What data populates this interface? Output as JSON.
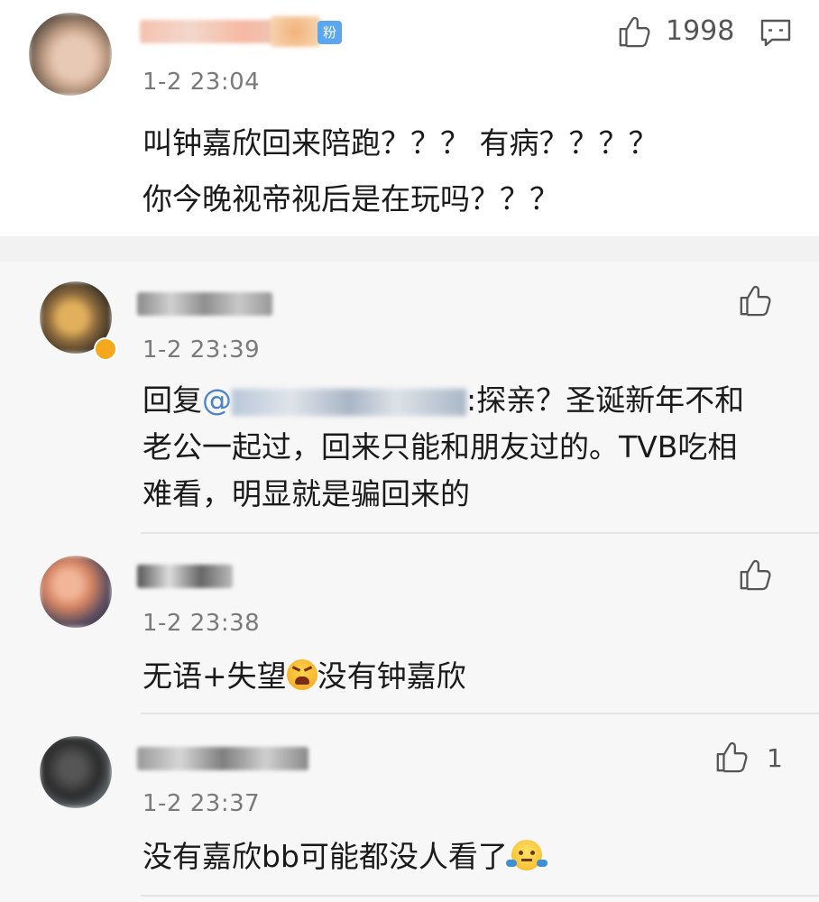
{
  "main_comment": {
    "fan_badge": "粉",
    "timestamp": "1-2 23:04",
    "like_count": "1998",
    "text_line1": "叫钟嘉欣回来陪跑？？？ 有病？？？？",
    "text_line2": "你今晚视帝视后是在玩吗？？？"
  },
  "replies": [
    {
      "timestamp": "1-2 23:39",
      "reply_prefix": "回复",
      "mention_at": "@",
      "mention_tail": "",
      "text_after_mention": ":探亲？圣诞新年不和",
      "text_line2": "老公一起过，回来只能和朋友过的。TVB吃相",
      "text_line3": "难看，明显就是骗回来的",
      "like_count": ""
    },
    {
      "timestamp": "1-2 23:38",
      "text_before_emoji": "无语+失望",
      "emoji": "angry-face-emoji",
      "text_after_emoji": "没有钟嘉欣",
      "like_count": ""
    },
    {
      "timestamp": "1-2 23:37",
      "text_before_emoji": "没有嘉欣bb可能都没人看了",
      "emoji": "shrug-emoji",
      "like_count": "1"
    }
  ],
  "colors": {
    "badge": "#5aa7ef",
    "mention": "#4a83c9",
    "timestamp": "#7a7a7a",
    "reply_bg": "#f7f7f7"
  }
}
